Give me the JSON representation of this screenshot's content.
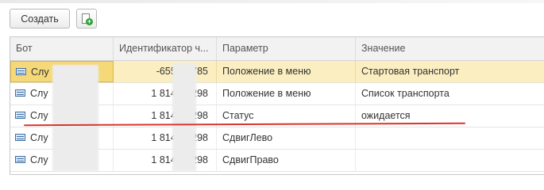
{
  "toolbar": {
    "create_label": "Создать",
    "add_icon": "document-add-icon"
  },
  "table": {
    "columns": [
      "Бот",
      "Идентификатор ч...",
      "Параметр",
      "Значение"
    ],
    "rows": [
      {
        "bot": "Слу",
        "id": "-655 🞄🞄🞄 785",
        "param": "Положение в меню",
        "value": "Стартовая транспорт",
        "selected": true
      },
      {
        "bot": "Слу",
        "id": "1 814 🞄🞄🞄 298",
        "param": "Положение в меню",
        "value": "Список транспорта"
      },
      {
        "bot": "Слу",
        "id": "1 814 🞄🞄🞄 298",
        "param": "Статус",
        "value": "ожидается"
      },
      {
        "bot": "Слу",
        "id": "1 814 🞄🞄🞄 298",
        "param": "СдвигЛево",
        "value": ""
      },
      {
        "bot": "Слу",
        "id": "1 814 🞄🞄🞄 298",
        "param": "СдвигПраво",
        "value": ""
      }
    ]
  },
  "colors": {
    "selected_row": "#fbefc1",
    "annotation_line": "#d8352e"
  }
}
